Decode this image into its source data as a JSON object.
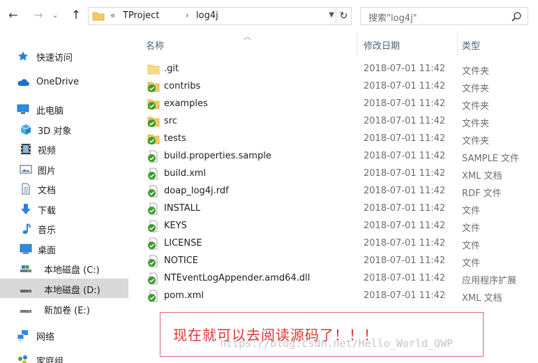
{
  "address": {
    "overflow_chevron": "«",
    "crumbs": [
      "TProject",
      "log4j"
    ],
    "separator": "›"
  },
  "search": {
    "placeholder": "搜索\"log4j\""
  },
  "nav": {
    "items": [
      {
        "label": "快速访问",
        "icon": "star-icon"
      },
      {
        "label": "OneDrive",
        "icon": "cloud-icon"
      },
      {
        "label": "此电脑",
        "icon": "computer-icon"
      },
      {
        "label": "3D 对象",
        "icon": "cube-icon"
      },
      {
        "label": "视频",
        "icon": "video-icon"
      },
      {
        "label": "图片",
        "icon": "picture-icon"
      },
      {
        "label": "文档",
        "icon": "document-icon"
      },
      {
        "label": "下载",
        "icon": "download-icon"
      },
      {
        "label": "音乐",
        "icon": "music-icon"
      },
      {
        "label": "桌面",
        "icon": "desktop-icon"
      },
      {
        "label": "本地磁盘 (C:)",
        "icon": "drive-icon"
      },
      {
        "label": "本地磁盘 (D:)",
        "icon": "drive-icon"
      },
      {
        "label": "新加卷 (E:)",
        "icon": "drive-icon"
      },
      {
        "label": "网络",
        "icon": "network-icon"
      },
      {
        "label": "家庭组",
        "icon": "homegroup-icon"
      }
    ]
  },
  "columns": {
    "name": "名称",
    "date": "修改日期",
    "type": "类型"
  },
  "files": [
    {
      "name": ".git",
      "date": "2018-07-01 11:42",
      "type": "文件夹",
      "kind": "folder-plain"
    },
    {
      "name": "contribs",
      "date": "2018-07-01 11:42",
      "type": "文件夹",
      "kind": "folder-synced"
    },
    {
      "name": "examples",
      "date": "2018-07-01 11:42",
      "type": "文件夹",
      "kind": "folder-synced"
    },
    {
      "name": "src",
      "date": "2018-07-01 11:42",
      "type": "文件夹",
      "kind": "folder-synced"
    },
    {
      "name": "tests",
      "date": "2018-07-01 11:42",
      "type": "文件夹",
      "kind": "folder-synced"
    },
    {
      "name": "build.properties.sample",
      "date": "2018-07-01 11:42",
      "type": "SAMPLE 文件",
      "kind": "file-synced"
    },
    {
      "name": "build.xml",
      "date": "2018-07-01 11:42",
      "type": "XML 文档",
      "kind": "file-synced"
    },
    {
      "name": "doap_log4j.rdf",
      "date": "2018-07-01 11:42",
      "type": "RDF 文件",
      "kind": "file-synced"
    },
    {
      "name": "INSTALL",
      "date": "2018-07-01 11:42",
      "type": "文件",
      "kind": "file-synced"
    },
    {
      "name": "KEYS",
      "date": "2018-07-01 11:42",
      "type": "文件",
      "kind": "file-synced"
    },
    {
      "name": "LICENSE",
      "date": "2018-07-01 11:42",
      "type": "文件",
      "kind": "file-synced"
    },
    {
      "name": "NOTICE",
      "date": "2018-07-01 11:42",
      "type": "文件",
      "kind": "file-synced"
    },
    {
      "name": "NTEventLogAppender.amd64.dll",
      "date": "2018-07-01 11:42",
      "type": "应用程序扩展",
      "kind": "file-synced"
    },
    {
      "name": "pom.xml",
      "date": "2018-07-01 11:42",
      "type": "XML 文档",
      "kind": "file-synced"
    }
  ],
  "annotation": {
    "text": "现在就可以去阅读源码了！！！"
  },
  "watermark": {
    "text": "https://blog.csdn.net/Hello_World_QWP"
  },
  "colors": {
    "folder": "#f3c964",
    "sync_green": "#3f9a2d",
    "selection": "#d9d9d9",
    "note_red": "#e03232"
  }
}
